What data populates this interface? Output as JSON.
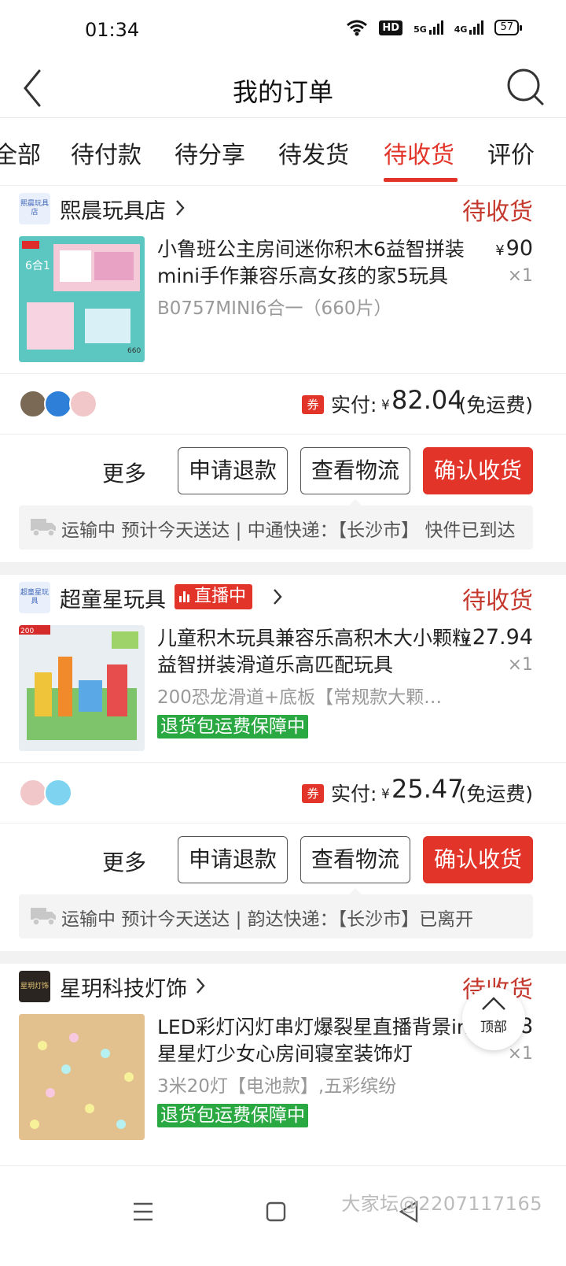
{
  "status_bar": {
    "time": "01:34",
    "hd": "HD",
    "net1": "5G",
    "net2": "4G",
    "battery": "57"
  },
  "header": {
    "title": "我的订单",
    "back_icon": "chevron-left-icon",
    "search_icon": "search-icon"
  },
  "tabs": [
    {
      "label": "全部"
    },
    {
      "label": "待付款"
    },
    {
      "label": "待分享"
    },
    {
      "label": "待发货"
    },
    {
      "label": "待收货",
      "active": true
    },
    {
      "label": "评价"
    }
  ],
  "colors": {
    "accent": "#e3342a",
    "status_red": "#c5382d",
    "guarantee_green": "#2aa842"
  },
  "orders": [
    {
      "shop_logo_text": "熙晨玩具店",
      "shop_name": "熙晨玩具店",
      "status": "待收货",
      "product_title": "小鲁班公主房间迷你积木6益智拼装mini手作兼容乐高女孩的家5玩具",
      "sku": "B0757MINI6合一（660片）",
      "price_symbol": "¥",
      "price": "90",
      "qty": "×1",
      "coupon": "券",
      "pay_label": "实付:",
      "pay_yen": "¥",
      "pay_amount": "82.04",
      "ship_note": "(免运费)",
      "more": "更多",
      "refund": "申请退款",
      "logistics_btn": "查看物流",
      "confirm": "确认收货",
      "logistics_text": "运输中 预计今天送达 | 中通快递：【长沙市】 快件已到达"
    },
    {
      "shop_logo_text": "超童星玩具",
      "shop_name": "超童星玩具",
      "live": "直播中",
      "status": "待收货",
      "product_title": "儿童积木玩具兼容乐高积木大小颗粒益智拼装滑道乐高匹配玩具",
      "sku": "200恐龙滑道+底板【常规款大颗粒】",
      "guarantee": "退货包运费保障中",
      "price_symbol": "¥",
      "price": "27.94",
      "qty": "×1",
      "coupon": "券",
      "pay_label": "实付:",
      "pay_yen": "¥",
      "pay_amount": "25.47",
      "ship_note": "(免运费)",
      "more": "更多",
      "refund": "申请退款",
      "logistics_btn": "查看物流",
      "confirm": "确认收货",
      "logistics_text": "运输中 预计今天送达 | 韵达快递：【长沙市】已离开"
    },
    {
      "shop_logo_text": "星玥灯饰",
      "shop_name": "星玥科技灯饰",
      "status": "待收货",
      "product_title": "LED彩灯闪灯串灯爆裂星直播背景ins星星灯少女心房间寝室装饰灯",
      "sku": "3米20灯【电池款】,五彩缤纷",
      "guarantee": "退货包运费保障中",
      "price_symbol": "¥",
      "price": "15.8",
      "qty": "×1"
    }
  ],
  "float_top": {
    "label": "顶部",
    "icon": "arrow-up-icon"
  },
  "navbar": {
    "watermark": "大家坛@2207117165"
  }
}
